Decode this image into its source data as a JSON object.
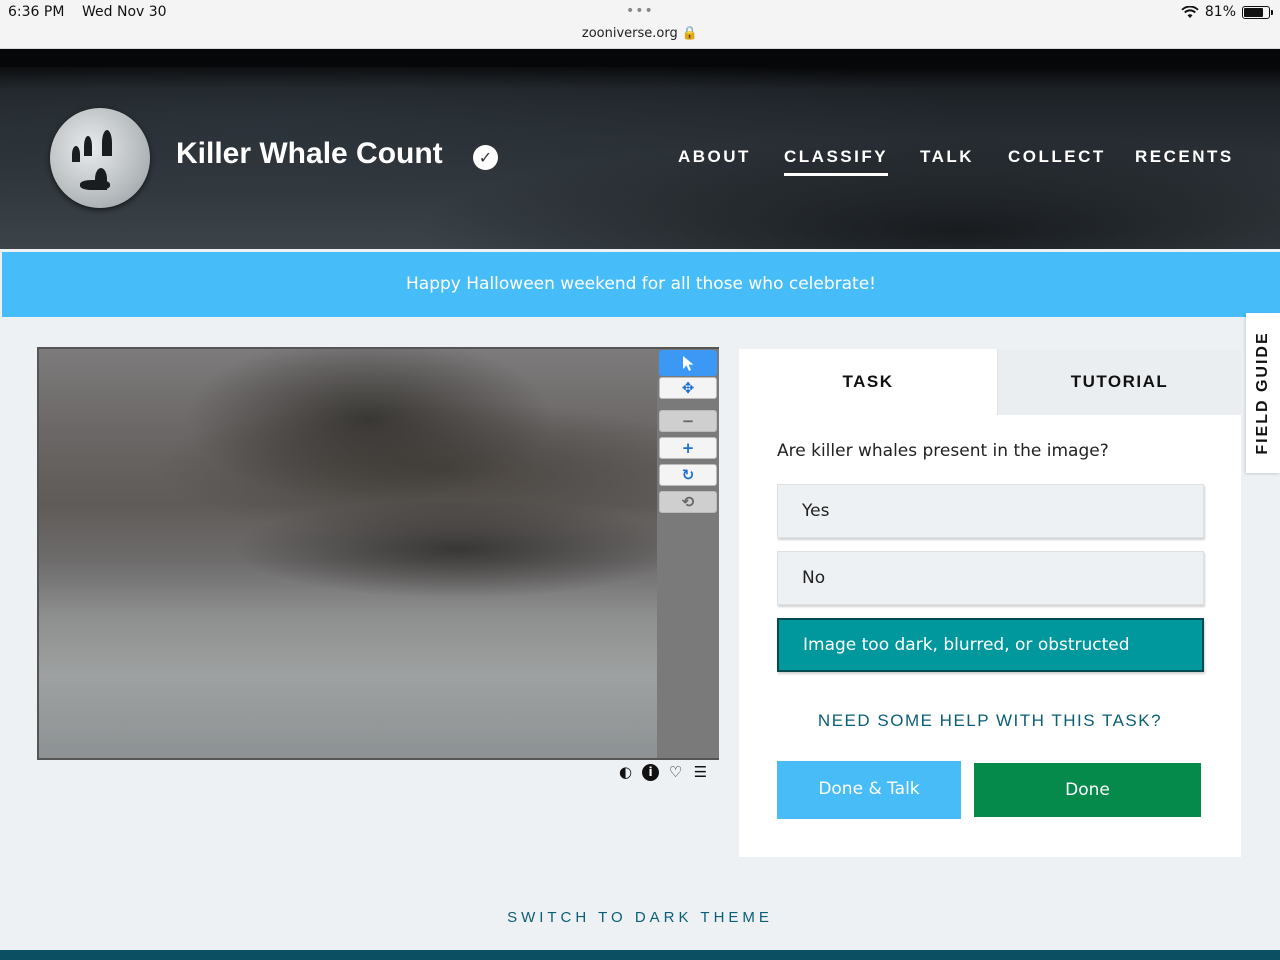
{
  "status_bar": {
    "time": "6:36 PM",
    "date": "Wed Nov 30",
    "url": "zooniverse.org 🔒",
    "battery": "81%",
    "battery_level": 0.81
  },
  "header": {
    "project_title": "Killer Whale Count",
    "nav": [
      "ABOUT",
      "CLASSIFY",
      "TALK",
      "COLLECT",
      "RECENTS"
    ],
    "active_nav": "CLASSIFY"
  },
  "banner": {
    "message": "Happy Halloween weekend for all those who celebrate!"
  },
  "task_panel": {
    "tabs": [
      "TASK",
      "TUTORIAL"
    ],
    "question": "Are killer whales present in the image?",
    "answers": [
      "Yes",
      "No",
      "Image too dark, blurred, or obstructed"
    ],
    "selected_answer": "Image too dark, blurred, or obstructed",
    "help_link": "NEED SOME HELP WITH THIS TASK?",
    "done_talk_label": "Done & Talk",
    "done_label": "Done"
  },
  "field_guide_label": "FIELD GUIDE",
  "footer": {
    "dark_theme_label": "SWITCH TO DARK THEME"
  },
  "colors": {
    "banner": "#46bdf9",
    "selected_answer": "#00979d",
    "done_button": "#068a4c",
    "done_talk_button": "#47bcf7",
    "link": "#0a5e76"
  }
}
